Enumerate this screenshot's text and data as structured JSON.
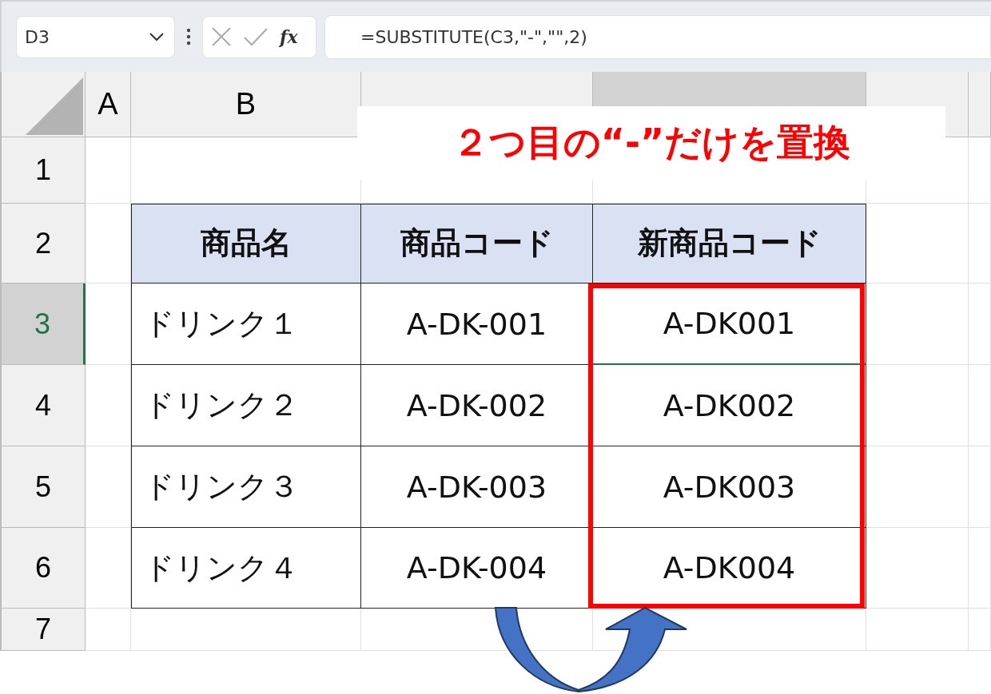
{
  "formula_bar": {
    "name_box": "D3",
    "function_label": "fx",
    "formula": "=SUBSTITUTE(C3,\"-\",\"\",2)"
  },
  "columns": [
    {
      "label": "A",
      "selected": false
    },
    {
      "label": "B",
      "selected": false
    },
    {
      "selected": false
    },
    {
      "selected": true
    },
    {
      "selected": false
    }
  ],
  "row_headers": [
    {
      "label": "1",
      "selected": false
    },
    {
      "label": "2",
      "selected": false
    },
    {
      "label": "3",
      "selected": true
    },
    {
      "label": "4",
      "selected": false
    },
    {
      "label": "5",
      "selected": false
    },
    {
      "label": "6",
      "selected": false
    },
    {
      "label": "7",
      "selected": false
    }
  ],
  "table": {
    "header": [
      "商品名",
      "商品コード",
      "新商品コード"
    ],
    "rows": [
      {
        "cells": [
          "ドリンク１",
          "A-DK-001",
          "A-DK001"
        ],
        "selected": true
      },
      {
        "cells": [
          "ドリンク２",
          "A-DK-002",
          "A-DK002"
        ],
        "selected": false
      },
      {
        "cells": [
          "ドリンク３",
          "A-DK-003",
          "A-DK003"
        ],
        "selected": false
      },
      {
        "cells": [
          "ドリンク４",
          "A-DK-004",
          "A-DK004"
        ],
        "selected": false
      }
    ]
  },
  "callout": "２つ目の“-”だけを置換"
}
